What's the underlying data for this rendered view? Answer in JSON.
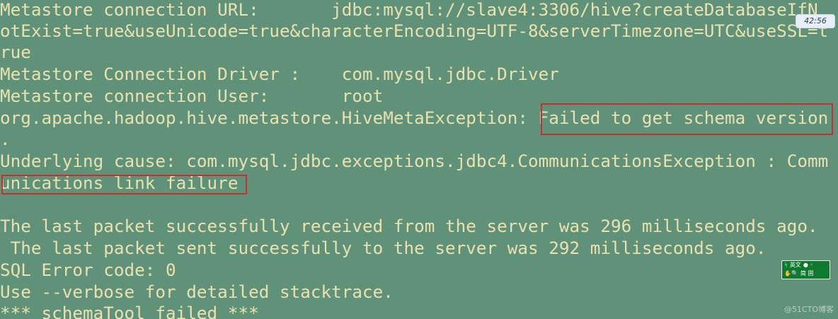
{
  "terminal": {
    "lines": [
      "Metastore connection URL:       jdbc:mysql://slave4:3306/hive?createDatabaseIfN",
      "otExist=true&useUnicode=true&characterEncoding=UTF-8&serverTimezone=UTC&useSSL=t",
      "rue",
      "Metastore Connection Driver :    com.mysql.jdbc.Driver",
      "Metastore connection User:       root",
      "org.apache.hadoop.hive.metastore.HiveMetaException: Failed to get schema version",
      ".",
      "Underlying cause: com.mysql.jdbc.exceptions.jdbc4.CommunicationsException : Comm",
      "unications link failure",
      "",
      "The last packet successfully received from the server was 296 milliseconds ago.",
      " The last packet sent successfully to the server was 292 milliseconds ago.",
      "SQL Error code: 0",
      "Use --verbose for detailed stacktrace.",
      "*** schemaTool failed ***"
    ]
  },
  "overlay": {
    "clock": "42:56",
    "ime": {
      "top_left": "ᛋ",
      "language": "英文",
      "top_right": "● ◦",
      "bottom_left": "✋🔍",
      "mode": "简 固"
    },
    "watermark": "@51CTO博客"
  },
  "colors": {
    "background": "#5f9279",
    "text": "#e9e1b0",
    "highlight": "#c53030",
    "ime_background": "#0d7a2d"
  }
}
